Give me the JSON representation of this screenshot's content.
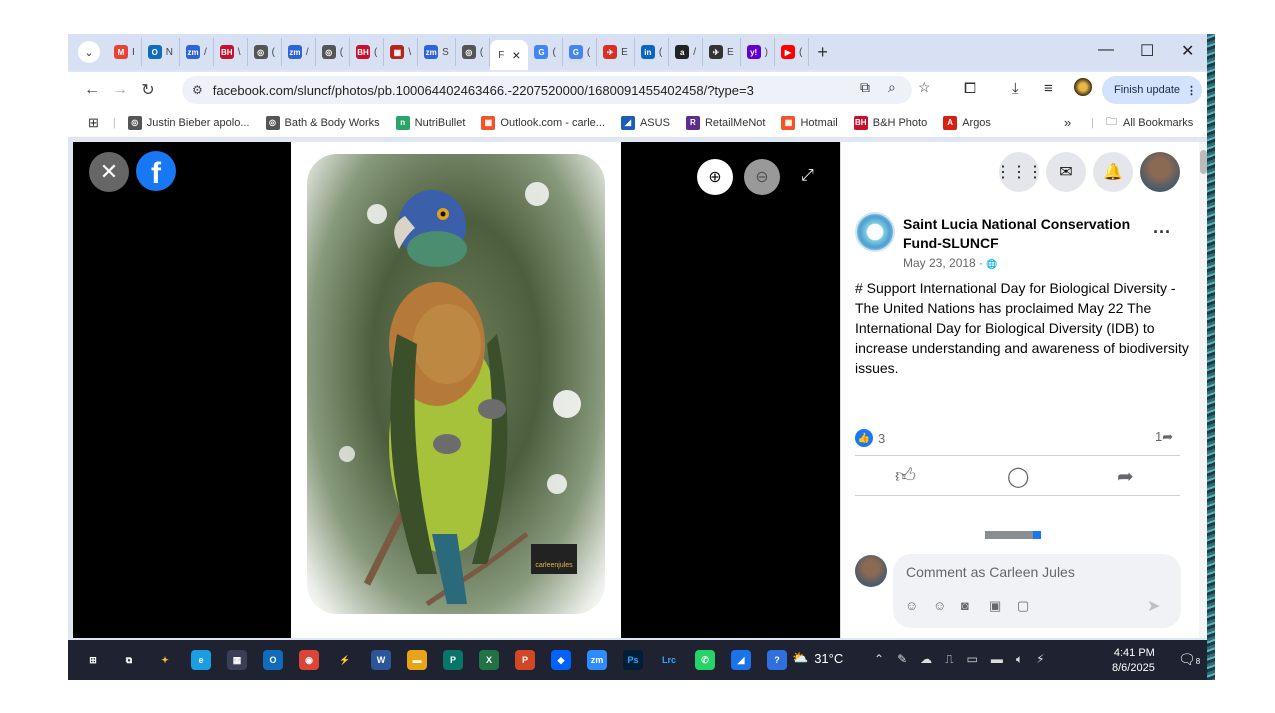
{
  "browser": {
    "tabs": [
      {
        "glyph": "M",
        "text": "I",
        "color": "#ea4335"
      },
      {
        "glyph": "O",
        "text": "N",
        "color": "#0f6cbd"
      },
      {
        "glyph": "zm",
        "text": "/",
        "color": "#2d64d8"
      },
      {
        "glyph": "BH",
        "text": "\\",
        "color": "#c8102e"
      },
      {
        "glyph": "◎",
        "text": "(",
        "color": "#555555"
      },
      {
        "glyph": "zm",
        "text": "/",
        "color": "#2d64d8"
      },
      {
        "glyph": "◎",
        "text": "(",
        "color": "#555555"
      },
      {
        "glyph": "BH",
        "text": "(",
        "color": "#c8102e"
      },
      {
        "glyph": "▦",
        "text": "\\",
        "color": "#b3261e"
      },
      {
        "glyph": "zm",
        "text": "S",
        "color": "#2d64d8"
      },
      {
        "glyph": "◎",
        "text": "(",
        "color": "#555555"
      }
    ],
    "active_tab": {
      "text": "F",
      "close": "×"
    },
    "tabs_after": [
      {
        "glyph": "G",
        "text": "(",
        "color": "#4285f4"
      },
      {
        "glyph": "G",
        "text": "(",
        "color": "#4285f4"
      },
      {
        "glyph": "✈",
        "text": "E",
        "color": "#d93025"
      },
      {
        "glyph": "in",
        "text": "(",
        "color": "#0a66c2"
      },
      {
        "glyph": "a",
        "text": "/",
        "color": "#222222"
      },
      {
        "glyph": "✈",
        "text": "E",
        "color": "#333333"
      },
      {
        "glyph": "y!",
        "text": ")",
        "color": "#6001d2"
      },
      {
        "glyph": "▶",
        "text": "(",
        "color": "#ff0000"
      }
    ],
    "new_tab": "+",
    "window_controls": {
      "minimize": "—",
      "maximize": "☐",
      "close": "✕"
    },
    "url": "facebook.com/sluncf/photos/pb.100064402463466.-2207520000/1680091455402458/?type=3",
    "finish_update": "Finish update",
    "bookmarks": [
      {
        "label": "Justin Bieber apolo...",
        "glyph": "◎",
        "color": "#555555"
      },
      {
        "label": "Bath & Body Works",
        "glyph": "◎",
        "color": "#555555"
      },
      {
        "label": "NutriBullet",
        "glyph": "n",
        "color": "#2aa56a"
      },
      {
        "label": "Outlook.com - carle...",
        "glyph": "▦",
        "color": "#f35325"
      },
      {
        "label": "ASUS",
        "glyph": "◢",
        "color": "#1a5fb4"
      },
      {
        "label": "RetailMeNot",
        "glyph": "R",
        "color": "#5b2d8e"
      },
      {
        "label": "Hotmail",
        "glyph": "▦",
        "color": "#f35325"
      },
      {
        "label": "B&H Photo",
        "glyph": "BH",
        "color": "#c8102e"
      },
      {
        "label": "Argos",
        "glyph": "A",
        "color": "#d42114"
      }
    ],
    "bookmarks_overflow": "»",
    "all_bookmarks": "All Bookmarks"
  },
  "viewer": {
    "close": "✕",
    "fb": "f",
    "watermark": "carleenjules",
    "zoom_in": "⊕",
    "zoom_out": "⊖",
    "fullscreen": "⤢"
  },
  "post": {
    "page_name": "Saint Lucia National Conservation Fund-SLUNCF",
    "date": "May 23, 2018 · ",
    "privacy_icon": "🌐",
    "more": "···",
    "lines": [
      "# Support International Day for Biological Diversity -",
      "The United Nations has proclaimed May 22 The International Day for Biological Diversity (IDB) to increase understanding and awareness of biodiversity issues."
    ],
    "likes": "3",
    "shares": "1",
    "comment_placeholder": "Comment as Carleen Jules"
  },
  "taskbar": {
    "temperature": "31°C",
    "time": "4:41 PM",
    "date": "8/6/2025",
    "notif_count": "8",
    "apps": [
      {
        "name": "start",
        "glyph": "⊞",
        "color": "#ffffff",
        "bg": "transparent"
      },
      {
        "name": "taskview",
        "glyph": "⧉",
        "color": "#ffffff",
        "bg": "transparent"
      },
      {
        "name": "copilot",
        "glyph": "✦",
        "color": "#ffb347",
        "bg": "transparent"
      },
      {
        "name": "edge",
        "glyph": "e",
        "color": "#ffffff",
        "bg": "#1b9de2"
      },
      {
        "name": "store",
        "glyph": "▦",
        "color": "#ffffff",
        "bg": "#3a3f55"
      },
      {
        "name": "outlook",
        "glyph": "O",
        "color": "#ffffff",
        "bg": "#0f6cbd"
      },
      {
        "name": "chrome",
        "glyph": "◉",
        "color": "#ffffff",
        "bg": "#db4437"
      },
      {
        "name": "perplexity",
        "glyph": "⚡",
        "color": "#ffffff",
        "bg": "transparent"
      },
      {
        "name": "word",
        "glyph": "W",
        "color": "#ffffff",
        "bg": "#2b579a"
      },
      {
        "name": "files",
        "glyph": "▬",
        "color": "#ffffff",
        "bg": "#e8a317"
      },
      {
        "name": "publisher",
        "glyph": "P",
        "color": "#ffffff",
        "bg": "#077568"
      },
      {
        "name": "excel",
        "glyph": "X",
        "color": "#ffffff",
        "bg": "#217346"
      },
      {
        "name": "powerpoint",
        "glyph": "P",
        "color": "#ffffff",
        "bg": "#d24726"
      },
      {
        "name": "dropbox",
        "glyph": "◆",
        "color": "#ffffff",
        "bg": "#0061fe"
      },
      {
        "name": "zoom",
        "glyph": "zm",
        "color": "#ffffff",
        "bg": "#2d8cff"
      },
      {
        "name": "photoshop",
        "glyph": "Ps",
        "color": "#31a8ff",
        "bg": "#001e36"
      },
      {
        "name": "lightroom",
        "glyph": "Lrc",
        "color": "#31a8ff",
        "bg": "transparent"
      },
      {
        "name": "whatsapp",
        "glyph": "✆",
        "color": "#ffffff",
        "bg": "#25d366"
      },
      {
        "name": "photos",
        "glyph": "◢",
        "color": "#ffffff",
        "bg": "#1a73e8"
      },
      {
        "name": "help",
        "glyph": "?",
        "color": "#ffffff",
        "bg": "#2f6fde"
      }
    ]
  }
}
